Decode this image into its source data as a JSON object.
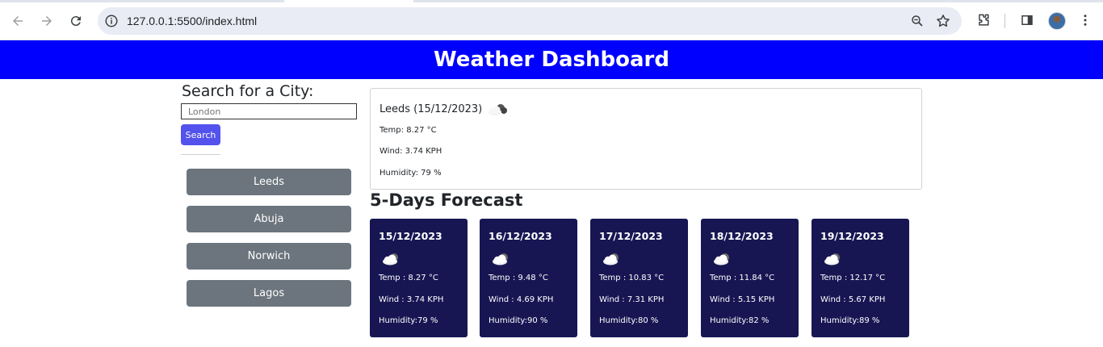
{
  "browser": {
    "url": "127.0.0.1:5500/index.html"
  },
  "header": {
    "title": "Weather Dashboard"
  },
  "search": {
    "title": "Search for a City:",
    "placeholder": "London",
    "button_label": "Search"
  },
  "history": [
    "Leeds",
    "Abuja",
    "Norwich",
    "Lagos"
  ],
  "current": {
    "city": "Leeds (15/12/2023)",
    "icon": "cloudy-icon",
    "temp": "Temp: 8.27 °C",
    "wind": "Wind: 3.74 KPH",
    "humidity": "Humidity: 79 %"
  },
  "forecast": {
    "title": "5-Days Forecast",
    "days": [
      {
        "date": "15/12/2023",
        "icon": "cloudy-icon",
        "temp": "Temp : 8.27 °C",
        "wind": "Wind : 3.74 KPH",
        "humidity": "Humidity:79 %"
      },
      {
        "date": "16/12/2023",
        "icon": "cloudy-icon",
        "temp": "Temp : 9.48 °C",
        "wind": "Wind : 4.69 KPH",
        "humidity": "Humidity:90 %"
      },
      {
        "date": "17/12/2023",
        "icon": "cloudy-icon",
        "temp": "Temp : 10.83 °C",
        "wind": "Wind : 7.31 KPH",
        "humidity": "Humidity:80 %"
      },
      {
        "date": "18/12/2023",
        "icon": "cloudy-icon",
        "temp": "Temp : 11.84 °C",
        "wind": "Wind : 5.15 KPH",
        "humidity": "Humidity:82 %"
      },
      {
        "date": "19/12/2023",
        "icon": "cloudy-icon",
        "temp": "Temp : 12.17 °C",
        "wind": "Wind : 5.67 KPH",
        "humidity": "Humidity:89 %"
      }
    ]
  },
  "colors": {
    "header_bg": "#0000ff",
    "card_bg": "#171653",
    "history_btn": "#6c757d",
    "search_btn": "#5352ed"
  }
}
